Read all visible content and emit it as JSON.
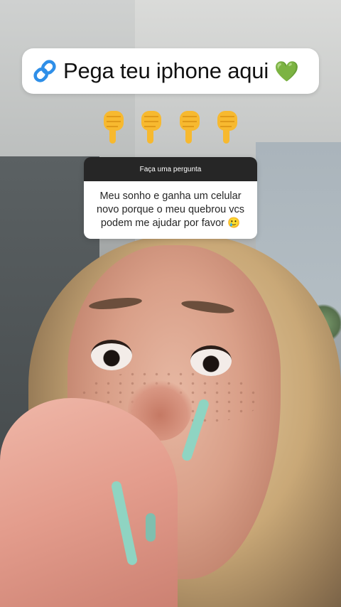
{
  "link_sticker": {
    "text": "Pega teu iphone aqui",
    "heart_emoji": "💚",
    "link_icon": "link-icon",
    "accent_color": "#2f8fe8"
  },
  "pointing_emojis": {
    "count": 4,
    "icon": "pointing-down-hand-icon",
    "color": "#f7b92f"
  },
  "question_box": {
    "header": "Faça uma pergunta",
    "question": "Meu sonho e ganha um celular novo porque o meu quebrou vcs podem me ajudar por favor 🥲"
  }
}
